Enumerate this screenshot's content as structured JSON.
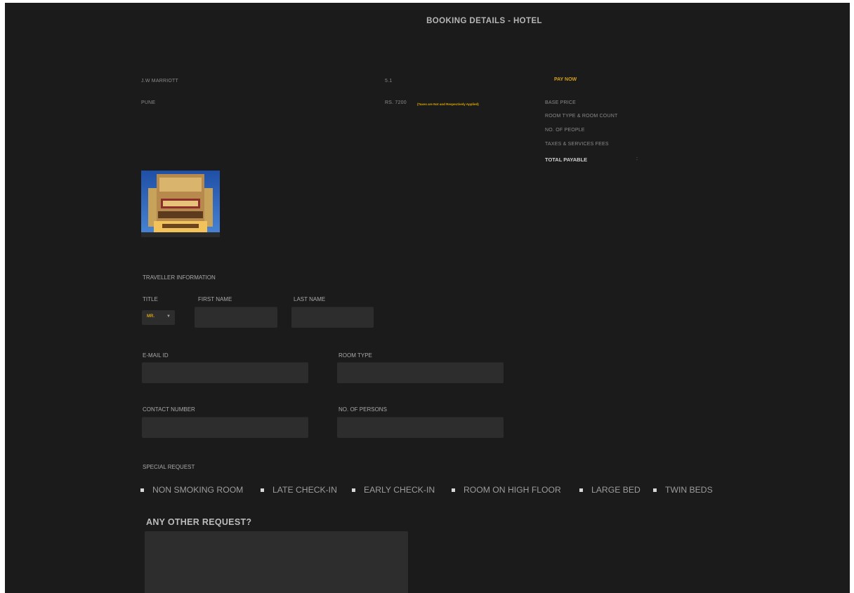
{
  "page": {
    "title": "BOOKING DETAILS - HOTEL"
  },
  "hotel": {
    "name": "J.W MARRIOTT",
    "city": "PUNE",
    "rating": "5.1",
    "price": "RS. 7200",
    "price_note": "(Taxes are Not and Respectively Applied)"
  },
  "payment": {
    "pay_label": "PAY NOW",
    "rows": [
      {
        "label": "BASE PRICE"
      },
      {
        "label": "ROOM TYPE & ROOM COUNT"
      },
      {
        "label": "NO. OF PEOPLE"
      },
      {
        "label": "TAXES & SERVICES FEES"
      }
    ],
    "total_label": "TOTAL PAYABLE",
    "total_value": ":"
  },
  "traveller": {
    "heading": "TRAVELLER INFORMATION",
    "title_label": "TITLE",
    "title_value": "MR.",
    "first_name_label": "FIRST NAME",
    "last_name_label": "LAST NAME",
    "email_label": "E-MAIL ID",
    "room_type_label": "ROOM TYPE",
    "contact_label": "CONTACT NUMBER",
    "persons_label": "NO. OF PERSONS"
  },
  "special": {
    "heading": "SPECIAL REQUEST",
    "options": [
      "NON SMOKING ROOM",
      "LATE CHECK-IN",
      "EARLY CHECK-IN",
      "ROOM ON HIGH FLOOR",
      "LARGE BED",
      "TWIN BEDS"
    ],
    "other_heading": "ANY OTHER REQUEST?"
  },
  "colors": {
    "background": "#1b1b1b",
    "accent": "#d4a017",
    "field": "#2d2d2d"
  },
  "icons": {
    "dropdown": "chevron-down-icon",
    "checkbox": "checkbox-icon"
  }
}
